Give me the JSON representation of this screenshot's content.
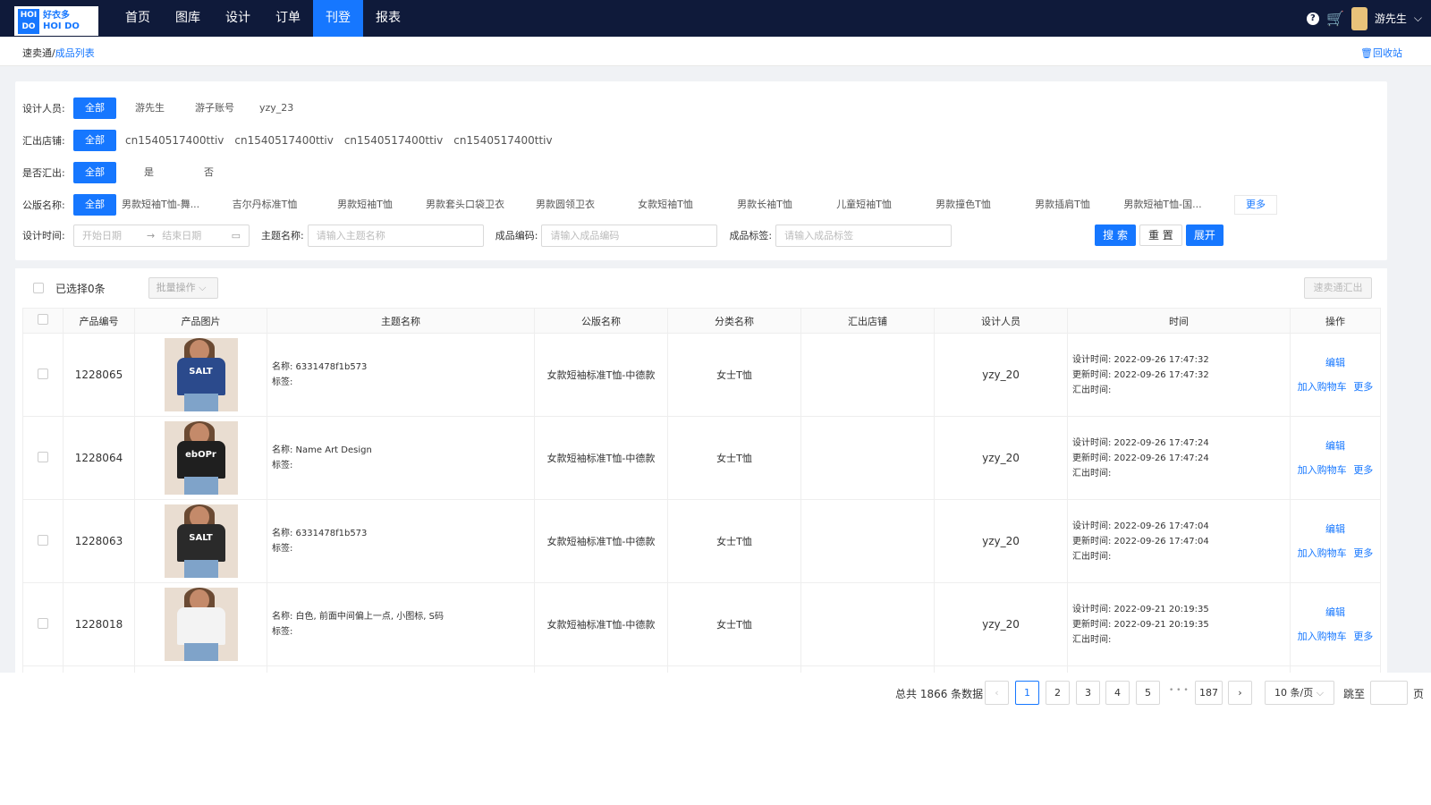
{
  "header": {
    "logo_line1": "HOI DO",
    "logo_line2": "好衣多",
    "logo_line3": "HOI DO",
    "nav": [
      "首页",
      "图库",
      "设计",
      "订单",
      "刊登",
      "报表"
    ],
    "active_nav": "刊登",
    "username": "游先生"
  },
  "breadcrumb": {
    "root": "速卖通/",
    "current": "成品列表",
    "recycle": "回收站"
  },
  "filters": {
    "designer": {
      "label": "设计人员:",
      "options": [
        "全部",
        "游先生",
        "游子账号",
        "yzy_23"
      ]
    },
    "store": {
      "label": "汇出店铺:",
      "options": [
        "全部",
        "cn1540517400ttiv",
        "cn1540517400ttiv",
        "cn1540517400ttiv",
        "cn1540517400ttiv"
      ]
    },
    "exported": {
      "label": "是否汇出:",
      "options": [
        "全部",
        "是",
        "否"
      ]
    },
    "template": {
      "label": "公版名称:",
      "options": [
        "全部",
        "男款短袖T恤-舞...",
        "吉尔丹标准T恤",
        "男款短袖T恤",
        "男款套头口袋卫衣",
        "男款圆领卫衣",
        "女款短袖T恤",
        "男款长袖T恤",
        "儿童短袖T恤",
        "男款撞色T恤",
        "男款插肩T恤",
        "男款短袖T恤-国..."
      ],
      "more": "更多"
    },
    "design_time": {
      "label": "设计时间:",
      "start_placeholder": "开始日期",
      "end_placeholder": "结束日期"
    },
    "theme": {
      "label": "主题名称:",
      "placeholder": "请输入主题名称"
    },
    "code": {
      "label": "成品编码:",
      "placeholder": "请输入成品编码"
    },
    "tag": {
      "label": "成品标签:",
      "placeholder": "请输入成品标签"
    },
    "buttons": {
      "search": "搜 索",
      "reset": "重 置",
      "expand": "展开"
    }
  },
  "toolbar": {
    "selected": "已选择0条",
    "batch": "批量操作",
    "export": "速卖通汇出"
  },
  "table": {
    "headers": [
      "",
      "产品编号",
      "产品图片",
      "主题名称",
      "公版名称",
      "分类名称",
      "汇出店铺",
      "设计人员",
      "时间",
      "操作"
    ],
    "rows": [
      {
        "id": "1228065",
        "name": "名称:  6331478f1b573",
        "tag": "标签:",
        "template": "女款短袖标准T恤-中德款",
        "category": "女士T恤",
        "store": "",
        "designer": "yzy_20",
        "design_time": "设计时间:  2022-09-26 17:47:32",
        "update_time": "更新时间:  2022-09-26 17:47:32",
        "export_time": "汇出时间:",
        "shirt_color": "#2b4a8c",
        "shirt_text": "SALT"
      },
      {
        "id": "1228064",
        "name": "名称:  Name Art Design",
        "tag": "标签:",
        "template": "女款短袖标准T恤-中德款",
        "category": "女士T恤",
        "store": "",
        "designer": "yzy_20",
        "design_time": "设计时间:  2022-09-26 17:47:24",
        "update_time": "更新时间:  2022-09-26 17:47:24",
        "export_time": "汇出时间:",
        "shirt_color": "#1f1f1f",
        "shirt_text": "ebOPr"
      },
      {
        "id": "1228063",
        "name": "名称:  6331478f1b573",
        "tag": "标签:",
        "template": "女款短袖标准T恤-中德款",
        "category": "女士T恤",
        "store": "",
        "designer": "yzy_20",
        "design_time": "设计时间:  2022-09-26 17:47:04",
        "update_time": "更新时间:  2022-09-26 17:47:04",
        "export_time": "汇出时间:",
        "shirt_color": "#2a2a2a",
        "shirt_text": "SALT"
      },
      {
        "id": "1228018",
        "name": "名称:  白色, 前面中间偏上一点, 小图标, S码",
        "tag": "标签:",
        "template": "女款短袖标准T恤-中德款",
        "category": "女士T恤",
        "store": "",
        "designer": "yzy_20",
        "design_time": "设计时间:  2022-09-21 20:19:35",
        "update_time": "更新时间:  2022-09-21 20:19:35",
        "export_time": "汇出时间:",
        "shirt_color": "#f3f3f3",
        "shirt_text": ""
      }
    ],
    "actions": {
      "edit": "编辑",
      "cart": "加入购物车",
      "more": "更多"
    }
  },
  "pagination": {
    "total": "总共 1866 条数据",
    "pages": [
      "1",
      "2",
      "3",
      "4",
      "5"
    ],
    "ellipsis": "• • •",
    "last": "187",
    "current": "1",
    "page_size": "10 条/页",
    "jump_label": "跳至",
    "page_unit": "页"
  },
  "colors": {
    "nav_bg": "#0f1a3a",
    "accent": "#1677ff"
  }
}
